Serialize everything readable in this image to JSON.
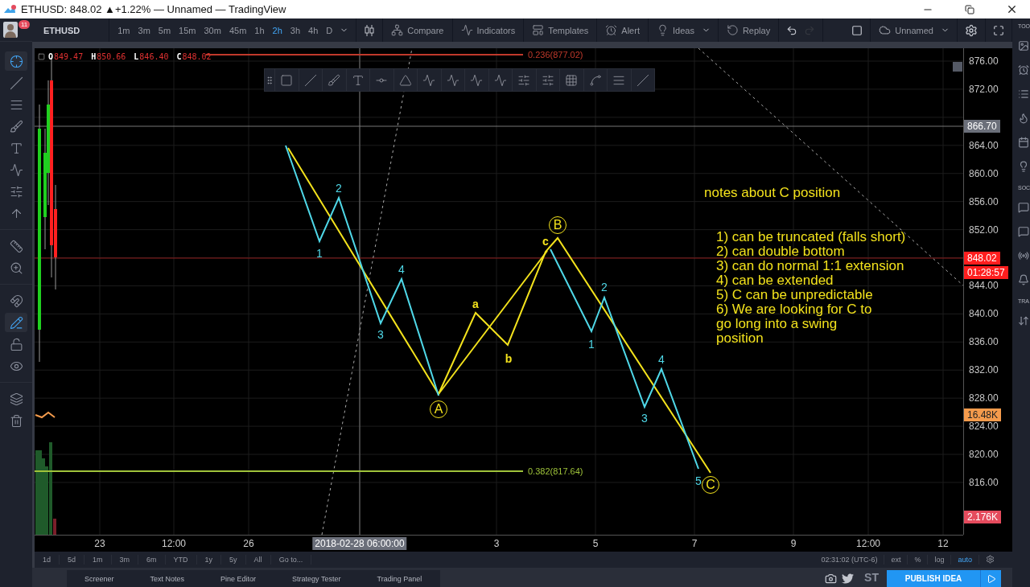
{
  "window": {
    "title": "ETHUSD: 848.02 ▲+1.22% — Unnamed — TradingView"
  },
  "account": {
    "badge": "11"
  },
  "toolbar": {
    "symbol": "ETHUSD",
    "intervals": [
      {
        "label": "1m",
        "selected": false
      },
      {
        "label": "3m",
        "selected": false
      },
      {
        "label": "5m",
        "selected": false
      },
      {
        "label": "15m",
        "selected": false
      },
      {
        "label": "30m",
        "selected": false
      },
      {
        "label": "45m",
        "selected": false
      },
      {
        "label": "1h",
        "selected": false
      },
      {
        "label": "2h",
        "selected": true
      },
      {
        "label": "3h",
        "selected": false
      },
      {
        "label": "4h",
        "selected": false
      },
      {
        "label": "D",
        "selected": false
      }
    ],
    "buttons": [
      {
        "kind": "compare",
        "label": "Compare"
      },
      {
        "kind": "indicators",
        "label": "Indicators"
      },
      {
        "kind": "templates",
        "label": "Templates"
      },
      {
        "kind": "alert",
        "label": "Alert"
      },
      {
        "kind": "ideas",
        "label": "Ideas"
      },
      {
        "kind": "replay",
        "label": "Replay"
      }
    ],
    "history": [
      {
        "kind": "undo",
        "disabled": false
      },
      {
        "kind": "redo",
        "disabled": true
      }
    ],
    "layout_name": "Unnamed"
  },
  "tools": [
    {
      "kind": "crosshair",
      "selected": true
    },
    {
      "kind": "line",
      "selected": false
    },
    {
      "kind": "fib",
      "selected": false
    },
    {
      "kind": "brush",
      "selected": false
    },
    {
      "kind": "text",
      "selected": false
    },
    {
      "kind": "pattern",
      "selected": false
    },
    {
      "kind": "prediction",
      "selected": false
    },
    {
      "kind": "arrow",
      "selected": false
    },
    {
      "kind": "ruler",
      "selected": false
    },
    {
      "kind": "zoom",
      "selected": false
    },
    {
      "kind": "magnet",
      "selected": false
    },
    {
      "kind": "drawing-mode",
      "selected": true
    },
    {
      "kind": "lock",
      "selected": false
    },
    {
      "kind": "eye",
      "selected": false
    },
    {
      "kind": "layers",
      "selected": false
    },
    {
      "kind": "trash",
      "selected": false
    }
  ],
  "legend": [
    {
      "label": "O",
      "value": "849.47"
    },
    {
      "label": "H",
      "value": "850.66"
    },
    {
      "label": "L",
      "value": "846.40"
    },
    {
      "label": "C",
      "value": "848.02"
    }
  ],
  "chart": {
    "fib_levels": [
      {
        "label": "0.236(877.02)",
        "color": "#c0392b"
      },
      {
        "label": "0.382(817.64)",
        "color": "#9fc33a"
      }
    ],
    "wave_labels": [
      {
        "text": "1",
        "color": "#4fd8e8"
      },
      {
        "text": "2",
        "color": "#4fd8e8"
      },
      {
        "text": "3",
        "color": "#4fd8e8"
      },
      {
        "text": "4",
        "color": "#4fd8e8"
      },
      {
        "text": "a",
        "color": "#f3e21c"
      },
      {
        "text": "b",
        "color": "#f3e21c"
      },
      {
        "text": "c",
        "color": "#f3e21c"
      },
      {
        "text": "1",
        "color": "#4fd8e8"
      },
      {
        "text": "2",
        "color": "#4fd8e8"
      },
      {
        "text": "3",
        "color": "#4fd8e8"
      },
      {
        "text": "4",
        "color": "#4fd8e8"
      },
      {
        "text": "5",
        "color": "#4fd8e8"
      }
    ],
    "circle_labels": [
      "A",
      "B",
      "C"
    ],
    "notes": {
      "title": "notes about C position",
      "lines": [
        "1) can be truncated (falls short)",
        "2) can double bottom",
        "3) can do normal 1:1 extension",
        "4) can be extended",
        "5) C can be unpredictable",
        "6) We are looking for C to go long into a swing position"
      ]
    }
  },
  "price_axis": {
    "ticks": [
      "876.00",
      "872.00",
      "864.00",
      "860.00",
      "856.00",
      "852.00",
      "844.00",
      "840.00",
      "836.00",
      "832.00",
      "828.00",
      "824.00",
      "820.00",
      "816.00"
    ],
    "tags": [
      {
        "kind": "crosshair",
        "text": "866.70"
      },
      {
        "kind": "last",
        "text": "848.02"
      },
      {
        "kind": "countdown",
        "text": "01:28:57"
      },
      {
        "kind": "indicator",
        "text": "16.48K"
      },
      {
        "kind": "volume",
        "text": "2.176K"
      }
    ]
  },
  "time_axis": [
    {
      "kind": "tick",
      "label": "23"
    },
    {
      "kind": "tick",
      "label": "12:00"
    },
    {
      "kind": "tick",
      "label": "26"
    },
    {
      "kind": "crosshair",
      "label": "2018-02-28 06:00:00"
    },
    {
      "kind": "tick",
      "label": "3"
    },
    {
      "kind": "tick",
      "label": "5"
    },
    {
      "kind": "tick",
      "label": "7"
    },
    {
      "kind": "tick",
      "label": "9"
    },
    {
      "kind": "tick",
      "label": "12:00"
    },
    {
      "kind": "tick",
      "label": "12"
    }
  ],
  "ranges": [
    "1d",
    "5d",
    "1m",
    "3m",
    "6m",
    "YTD",
    "1y",
    "5y",
    "All",
    "Go to..."
  ],
  "scale": {
    "clock": "02:31:02 (UTC-6)",
    "options": [
      {
        "label": "ext",
        "selected": false
      },
      {
        "label": "%",
        "selected": false
      },
      {
        "label": "log",
        "selected": false
      },
      {
        "label": "auto",
        "selected": true
      }
    ]
  },
  "bottom_tabs": [
    "Screener",
    "Text Notes",
    "Pine Editor",
    "Strategy Tester",
    "Trading Panel"
  ],
  "share": {
    "stocktwits": "ST",
    "publish": "PUBLISH IDEA"
  },
  "side_panel": {
    "headings": [
      "TOO",
      "SOC",
      "TRA"
    ]
  }
}
